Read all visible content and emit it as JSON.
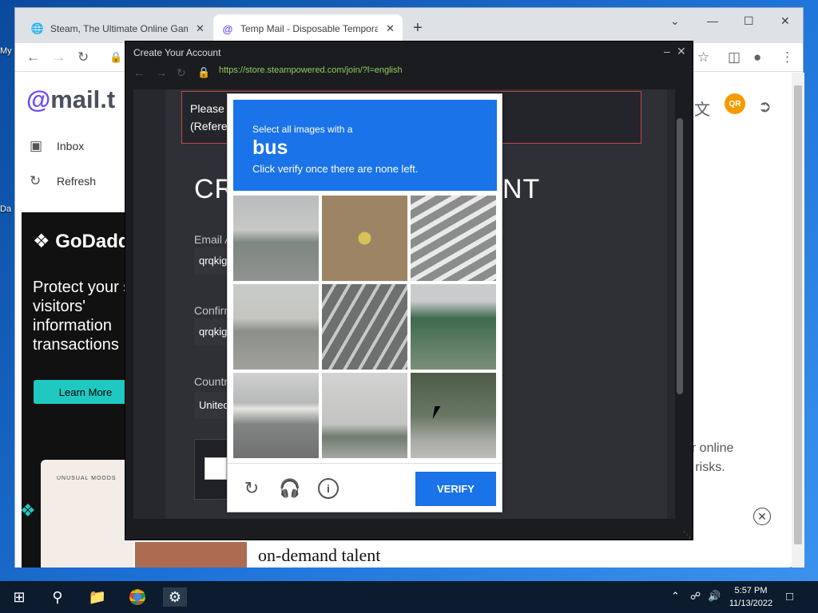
{
  "desktop": {
    "icon1_label": "My",
    "icon2_label": "Da"
  },
  "browser": {
    "tabs": [
      {
        "title": "Steam, The Ultimate Online Gam",
        "icon": "globe-icon"
      },
      {
        "title": "Temp Mail - Disposable Tempora",
        "icon": "at-icon"
      }
    ],
    "new_tab_label": "+"
  },
  "mailtm": {
    "logo_at": "@",
    "logo_text": "mail.t",
    "nav": {
      "inbox": "Inbox",
      "refresh": "Refresh"
    },
    "qr_label": "QR",
    "ad": {
      "brand": "GoDadd",
      "text": "Protect your site visitors' information transactions",
      "learn_more": "Learn More",
      "card_label": "UNUSUAL MOODS"
    },
    "right_line1": "er online",
    "right_line2": "o risks.",
    "bottom_text": "on-demand talent"
  },
  "steam": {
    "window_title": "Create Your Account",
    "url": "https://store.steampowered.com/join/?l=english",
    "notice_line1": "Please c",
    "notice_line2": "(Referen",
    "heading_left": "CR",
    "heading_right": "NT",
    "email_label": "Email A",
    "email_value": "qrqkigo",
    "confirm_label": "Confirm",
    "confirm_value": "qrqkigo",
    "country_label": "Country",
    "country_value": "United"
  },
  "captcha": {
    "instruction": "Select all images with a",
    "target": "bus",
    "subtext": "Click verify once there are none left.",
    "verify_label": "VERIFY"
  },
  "taskbar": {
    "time": "5:57 PM",
    "date": "11/13/2022"
  }
}
